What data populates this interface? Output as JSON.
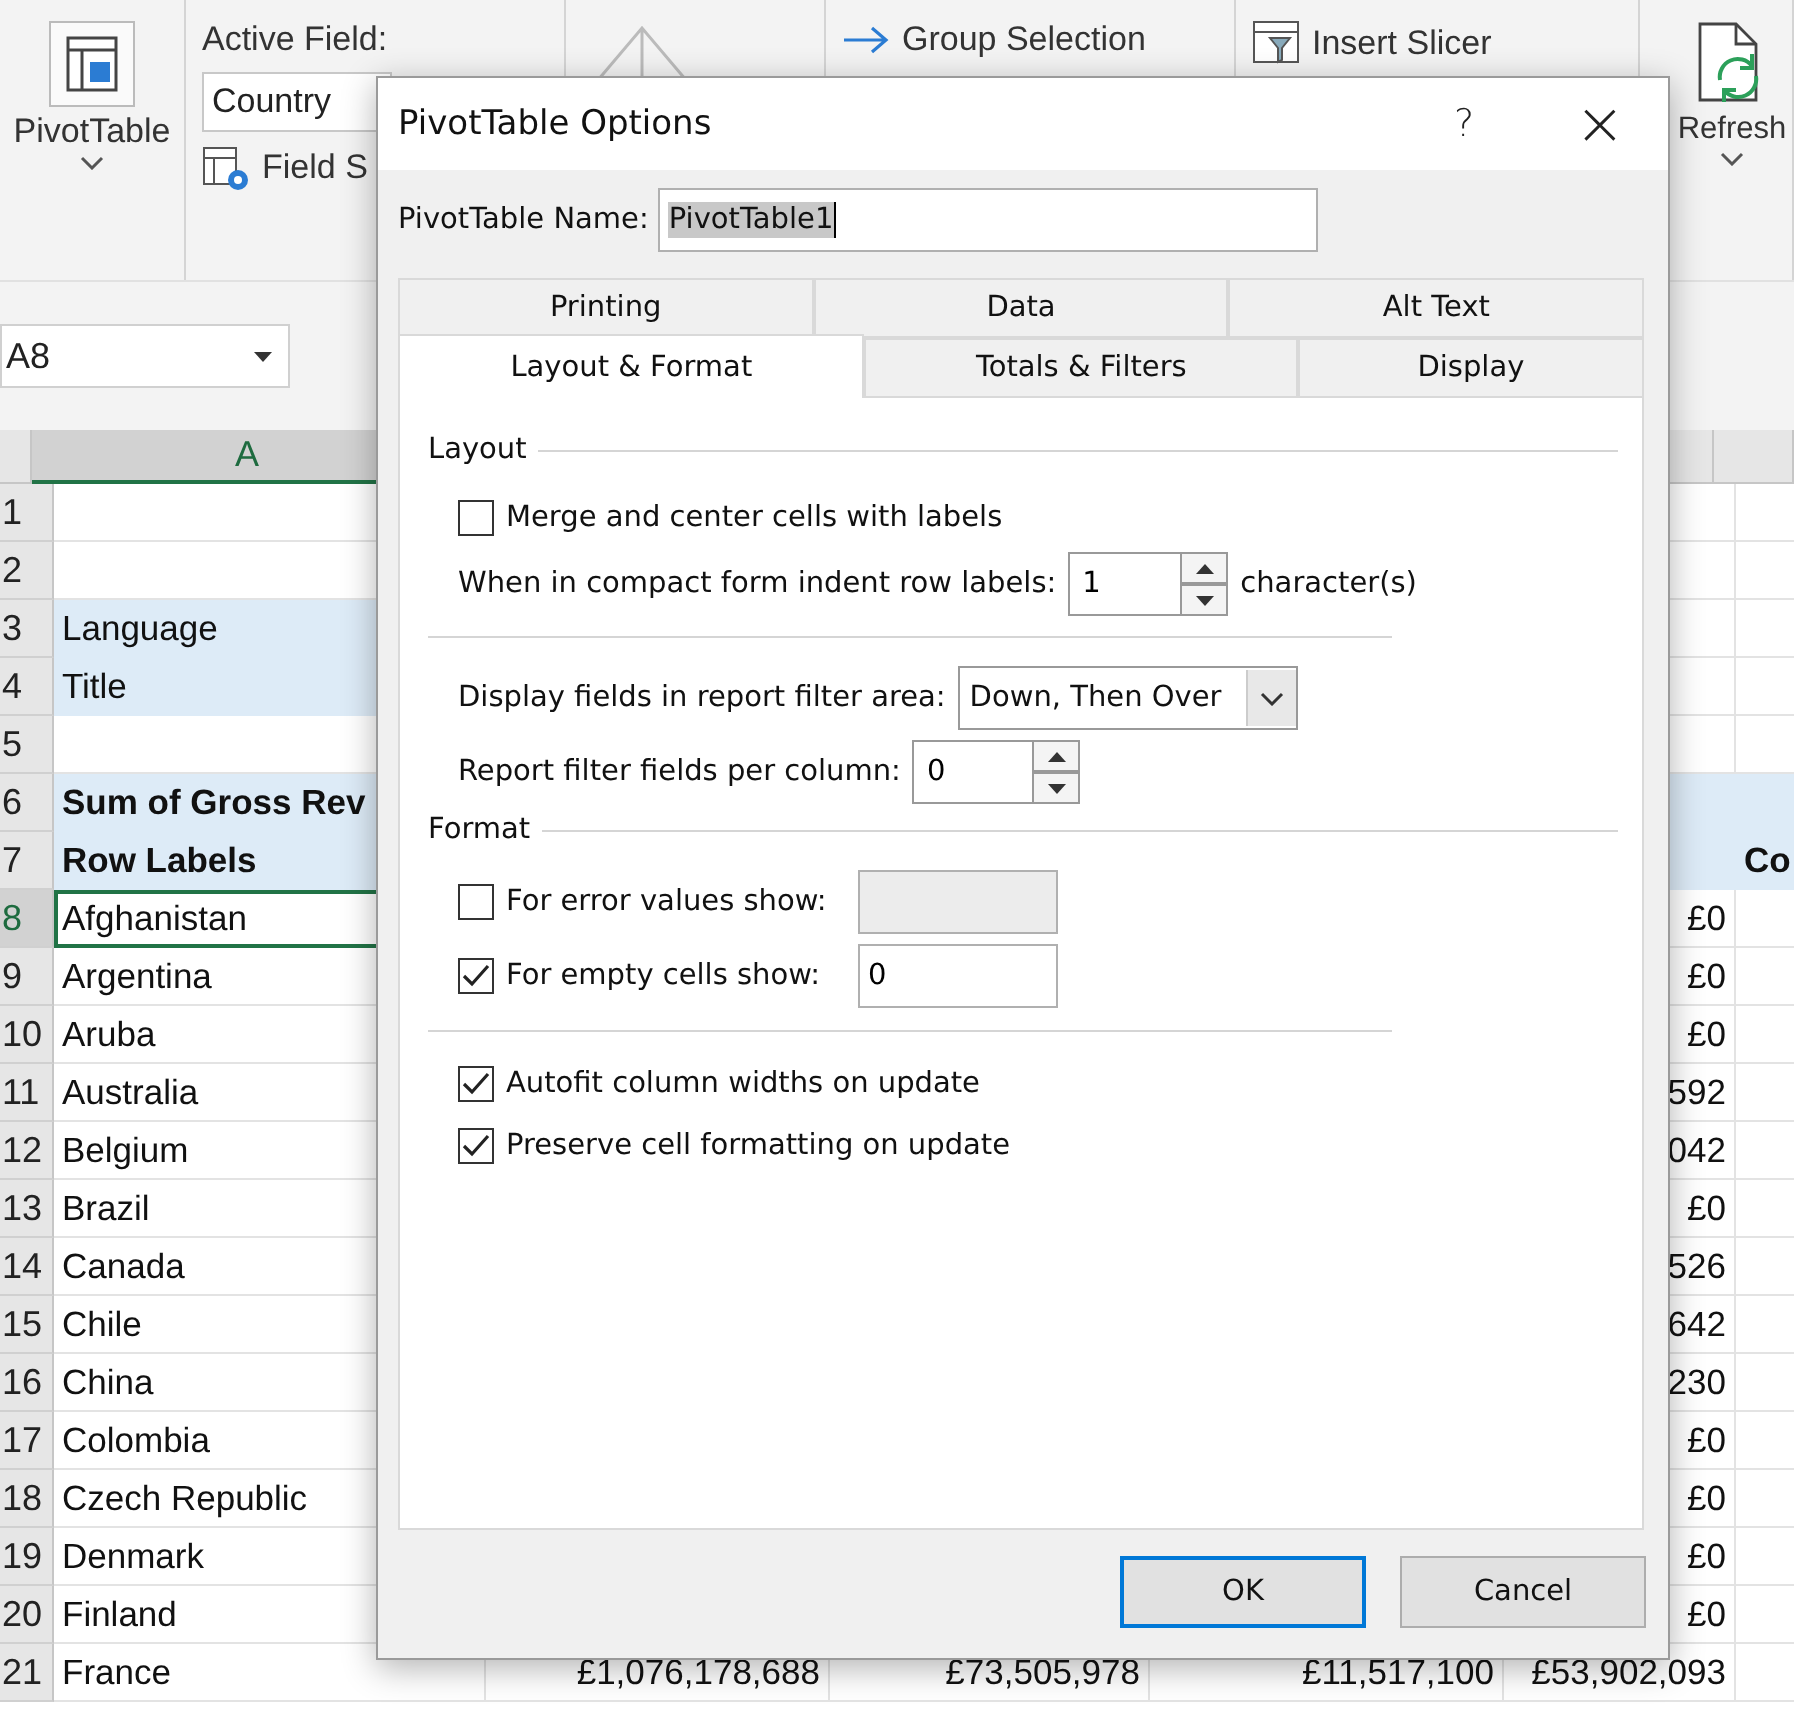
{
  "ribbon": {
    "pivottable_button": {
      "label": "PivotTable"
    },
    "active_field": {
      "label": "Active Field:",
      "value": "Country"
    },
    "field_settings": {
      "label": "Field S"
    },
    "group_selection": {
      "label": "Group Selection"
    },
    "insert_slicer": {
      "label": "Insert Slicer"
    },
    "refresh": {
      "label": "Refresh"
    }
  },
  "name_box": {
    "value": "A8"
  },
  "sheet": {
    "columns": [
      {
        "label": "A",
        "selected": true
      }
    ],
    "rows": [
      {
        "number": "1",
        "selected": false,
        "shaded": false
      },
      {
        "number": "2",
        "selected": false,
        "shaded": false
      },
      {
        "number": "3",
        "selected": false,
        "shaded": true,
        "col_a": "Language"
      },
      {
        "number": "4",
        "selected": false,
        "shaded": true,
        "col_a": "Title"
      },
      {
        "number": "5",
        "selected": false,
        "shaded": false
      },
      {
        "number": "6",
        "selected": false,
        "shaded": true,
        "header_band": true,
        "col_a": "Sum of Gross Rev"
      },
      {
        "number": "7",
        "selected": false,
        "shaded": true,
        "header_band": true,
        "col_a": "Row Labels",
        "col_f": "Co"
      },
      {
        "number": "8",
        "selected": true,
        "shaded": false,
        "col_a": "Afghanistan",
        "col_e": "£0"
      },
      {
        "number": "9",
        "selected": false,
        "shaded": false,
        "col_a": "Argentina",
        "col_e": "£0"
      },
      {
        "number": "10",
        "selected": false,
        "shaded": false,
        "col_a": "Aruba",
        "col_e": "£0"
      },
      {
        "number": "11",
        "selected": false,
        "shaded": false,
        "col_a": "Australia",
        "col_e": "592"
      },
      {
        "number": "12",
        "selected": false,
        "shaded": false,
        "col_a": "Belgium",
        "col_e": "042"
      },
      {
        "number": "13",
        "selected": false,
        "shaded": false,
        "col_a": "Brazil",
        "col_e": "£0"
      },
      {
        "number": "14",
        "selected": false,
        "shaded": false,
        "col_a": "Canada",
        "col_e": "526"
      },
      {
        "number": "15",
        "selected": false,
        "shaded": false,
        "col_a": "Chile",
        "col_e": "642"
      },
      {
        "number": "16",
        "selected": false,
        "shaded": false,
        "col_a": "China",
        "col_e": "230"
      },
      {
        "number": "17",
        "selected": false,
        "shaded": false,
        "col_a": "Colombia",
        "col_e": "£0"
      },
      {
        "number": "18",
        "selected": false,
        "shaded": false,
        "col_a": "Czech Republic",
        "col_e": "£0"
      },
      {
        "number": "19",
        "selected": false,
        "shaded": false,
        "col_a": "Denmark",
        "col_e": "£0"
      },
      {
        "number": "20",
        "selected": false,
        "shaded": false,
        "col_a": "Finland",
        "col_e": "£0"
      },
      {
        "number": "21",
        "selected": false,
        "shaded": false,
        "col_a": "France",
        "col_b": "£1,076,178,688",
        "col_c": "£73,505,978",
        "col_d": "£11,517,100",
        "col_e": "£53,902,093"
      }
    ]
  },
  "dialog": {
    "title": "PivotTable Options",
    "help": "?",
    "close": "×",
    "name": {
      "label": "PivotTable Name:",
      "value": "PivotTable1"
    },
    "tabs_back_row": [
      {
        "label": "Printing",
        "selected": false
      },
      {
        "label": "Data",
        "selected": false
      },
      {
        "label": "Alt Text",
        "selected": false
      }
    ],
    "tabs_front_row": [
      {
        "label": "Layout & Format",
        "selected": true
      },
      {
        "label": "Totals & Filters",
        "selected": false
      },
      {
        "label": "Display",
        "selected": false
      }
    ],
    "layout": {
      "heading": "Layout",
      "merge": {
        "label": "Merge and center cells with labels",
        "checked": false
      },
      "indent": {
        "label": "When in compact form indent row labels:",
        "value": "1",
        "unit": "character(s)"
      },
      "filter_area": {
        "label": "Display fields in report filter area:",
        "value": "Down, Then Over"
      },
      "filter_fields": {
        "label": "Report filter fields per column:",
        "value": "0"
      }
    },
    "format": {
      "heading": "Format",
      "error_values": {
        "label": "For error values show:",
        "checked": false
      },
      "empty_cells": {
        "label": "For empty cells show:",
        "checked": true,
        "value": "0"
      },
      "autofit": {
        "label": "Autofit column widths on update",
        "checked": true
      },
      "preserve": {
        "label": "Preserve cell formatting on update",
        "checked": true
      }
    },
    "buttons": [
      {
        "label": "OK",
        "kind": "default"
      },
      {
        "label": "Cancel",
        "kind": "normal"
      }
    ]
  }
}
